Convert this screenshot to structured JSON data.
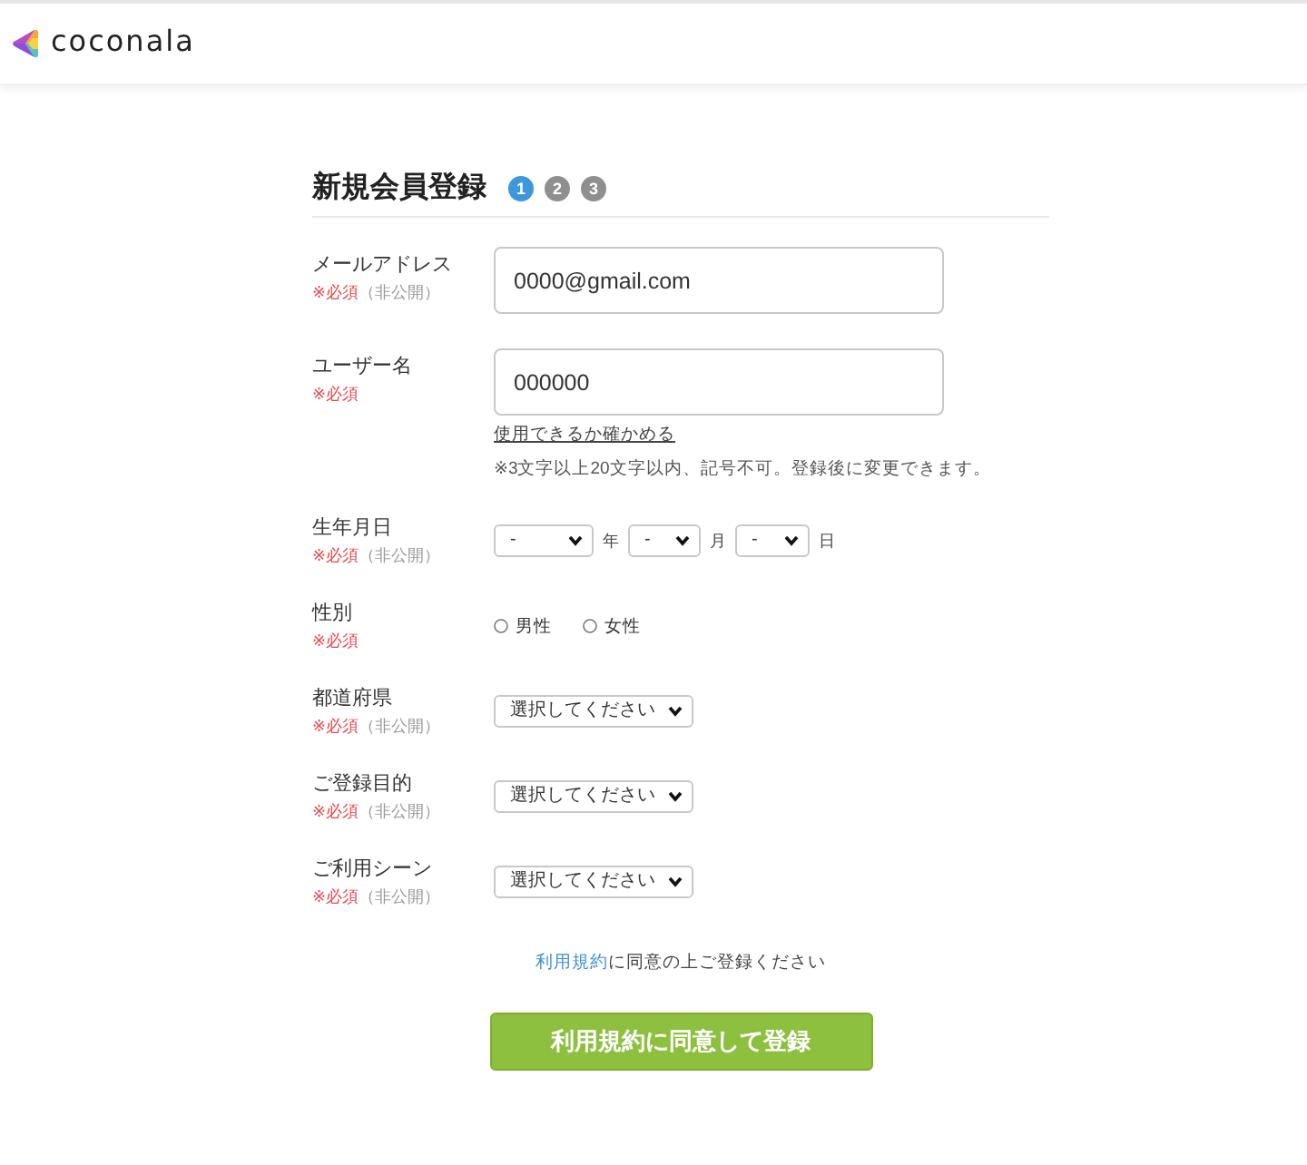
{
  "header": {
    "logo_text": "coconala"
  },
  "title": "新規会員登録",
  "steps": [
    {
      "label": "1",
      "selected": true
    },
    {
      "label": "2",
      "selected": false
    },
    {
      "label": "3",
      "selected": false
    }
  ],
  "fields": [
    {
      "kind": "text",
      "label": "メールアドレス",
      "required": "※必須",
      "private": "（非公開）",
      "value": "0000@gmail.com"
    },
    {
      "kind": "text",
      "label": "ユーザー名",
      "required": "※必須",
      "value": "000000",
      "link": "使用できるか確かめる",
      "note": "※3文字以上20文字以内、記号不可。登録後に変更できます。"
    },
    {
      "kind": "date",
      "label": "生年月日",
      "required": "※必須",
      "private": "（非公開）",
      "selects": [
        {
          "value": "-",
          "unit": "年"
        },
        {
          "value": "-",
          "unit": "月"
        },
        {
          "value": "-",
          "unit": "日"
        }
      ]
    },
    {
      "kind": "radio",
      "label": "性別",
      "required": "※必須",
      "options": [
        {
          "label": "男性",
          "selected": false
        },
        {
          "label": "女性",
          "selected": false
        }
      ]
    },
    {
      "kind": "select",
      "label": "都道府県",
      "required": "※必須",
      "private": "（非公開）",
      "value": "選択してください"
    },
    {
      "kind": "select",
      "label": "ご登録目的",
      "required": "※必須",
      "private": "（非公開）",
      "value": "選択してください"
    },
    {
      "kind": "select",
      "label": "ご利用シーン",
      "required": "※必須",
      "private": "（非公開）",
      "value": "選択してください"
    }
  ],
  "terms": {
    "link": "利用規約",
    "text": "に同意の上ご登録ください"
  },
  "submit_button": "利用規約に同意して登録"
}
